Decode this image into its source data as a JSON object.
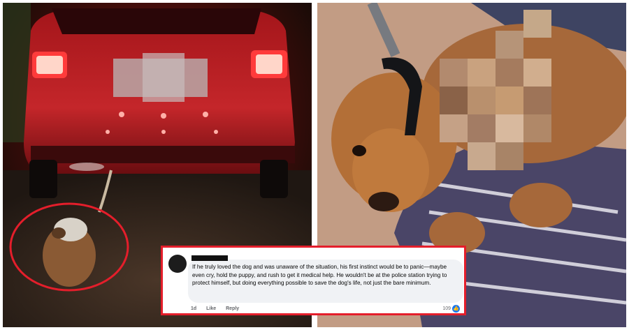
{
  "comment": {
    "text": "If he truly loved the dog and was unaware of the situation, his first instinct would be to panic—maybe even cry, hold the puppy, and rush to get it medical help. He wouldn't be at the police station trying to protect himself, but doing everything possible to save the dog's life, not just the bare minimum.",
    "time": "1d",
    "like_label": "Like",
    "reply_label": "Reply",
    "reaction_count": "109",
    "reaction_icon": "like-thumb-icon"
  },
  "colors": {
    "highlight_red": "#e41e2b",
    "facebook_blue": "#1877f2",
    "bubble_grey": "#f0f2f5"
  }
}
